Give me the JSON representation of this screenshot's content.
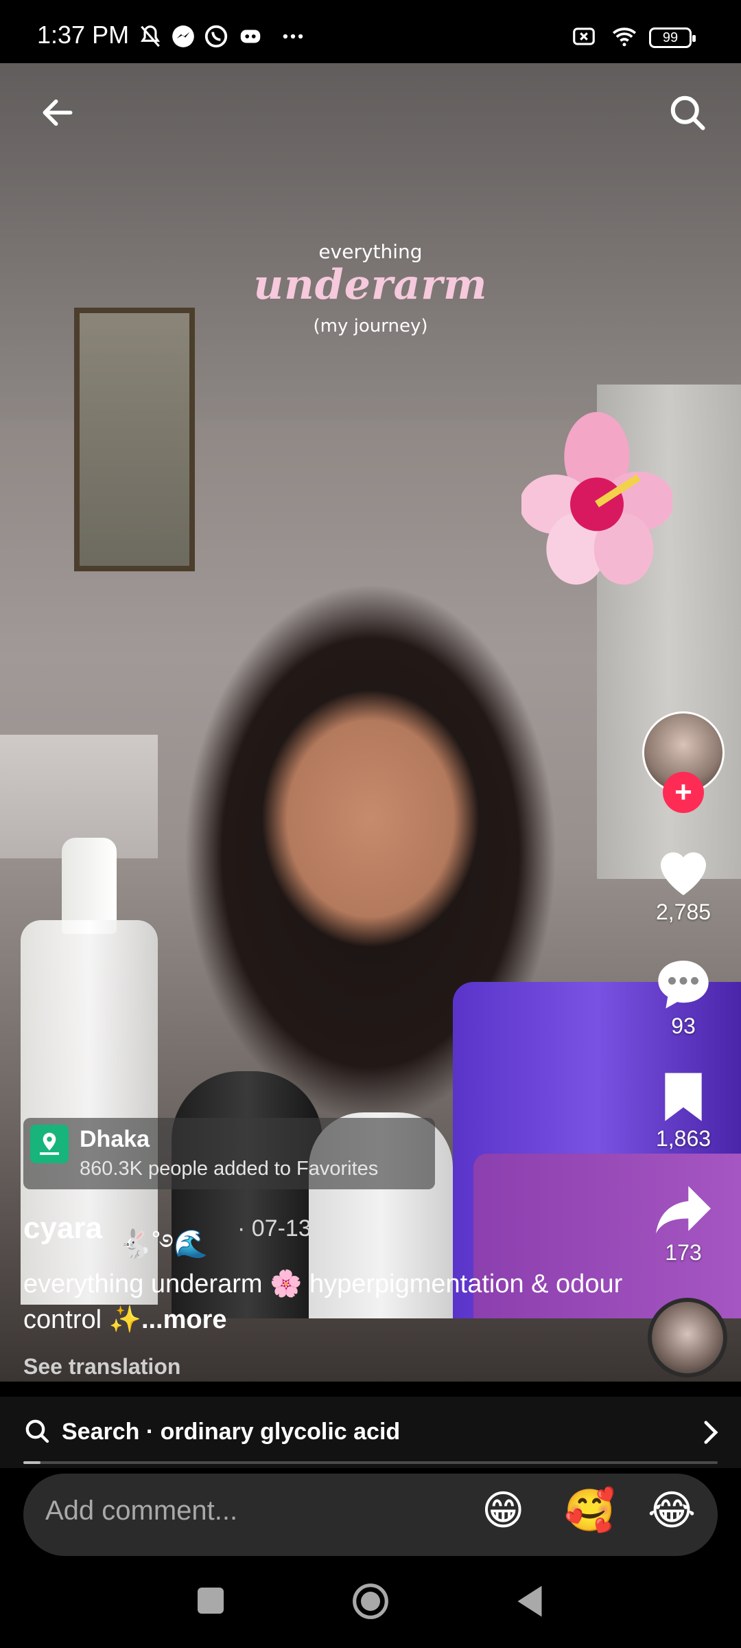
{
  "status_bar": {
    "time": "1:37 PM",
    "battery": "99",
    "icons": [
      "mute-icon",
      "messenger-icon",
      "whatsapp-icon",
      "discord-icon",
      "more-dots-icon",
      "x-box-icon",
      "wifi-icon",
      "battery-icon"
    ]
  },
  "video_overlay": {
    "line1": "everything",
    "line2": "underarm",
    "line3": "(my journey)"
  },
  "right_rail": {
    "like_count": "2,785",
    "comment_count": "93",
    "favorite_count": "1,863",
    "share_count": "173",
    "follow_symbol": "+",
    "accent": "#fe2c55"
  },
  "location": {
    "name": "Dhaka",
    "subtitle": "860.3K people added to Favorites"
  },
  "post": {
    "username": "cyara",
    "user_emoji": "🐇˚࿔🌊",
    "date": "· 07-13",
    "caption_main": "everything underarm 🌸 hyperpigmentation & odour control ✨",
    "caption_more": "...more",
    "see_translation": "See translation"
  },
  "search_suggestion": {
    "text": "Search · ordinary glycolic acid",
    "progress_fraction": 0.025
  },
  "comment_bar": {
    "placeholder": "Add comment...",
    "emojis": [
      "😁",
      "🥰",
      "😂"
    ]
  }
}
